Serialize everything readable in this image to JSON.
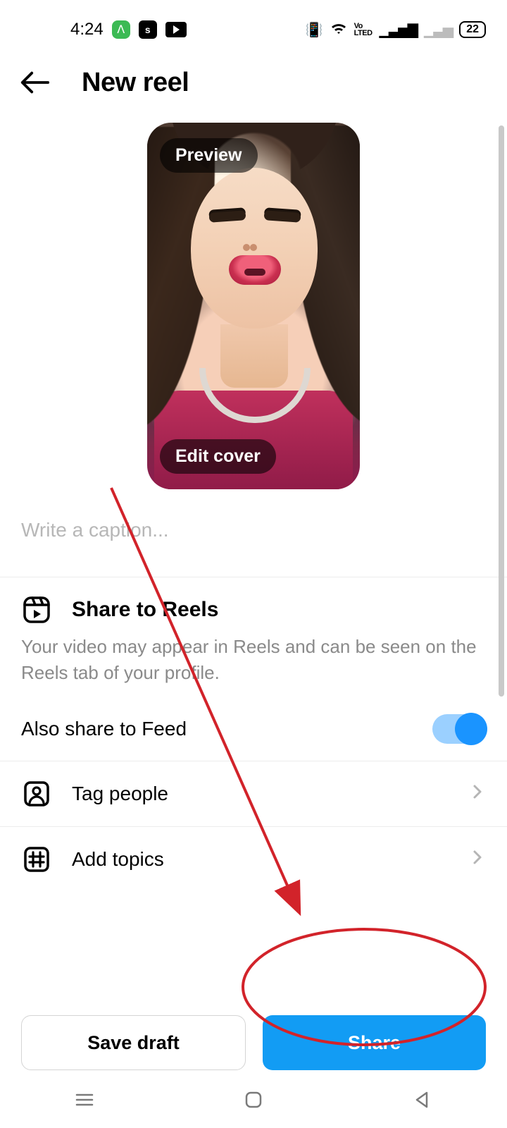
{
  "status": {
    "time": "4:24",
    "vo": "Vo\nLTED",
    "battery": "22"
  },
  "header": {
    "title": "New reel"
  },
  "thumb": {
    "preview": "Preview",
    "edit_cover": "Edit cover"
  },
  "caption": {
    "placeholder": "Write a caption..."
  },
  "reels": {
    "title": "Share to Reels",
    "desc": "Your video may appear in Reels and can be seen on the Reels tab of your profile."
  },
  "feed": {
    "label": "Also share to Feed",
    "on": true
  },
  "rows": {
    "tag": "Tag people",
    "topics": "Add topics"
  },
  "buttons": {
    "draft": "Save draft",
    "share": "Share"
  },
  "colors": {
    "primary": "#129cf4"
  }
}
